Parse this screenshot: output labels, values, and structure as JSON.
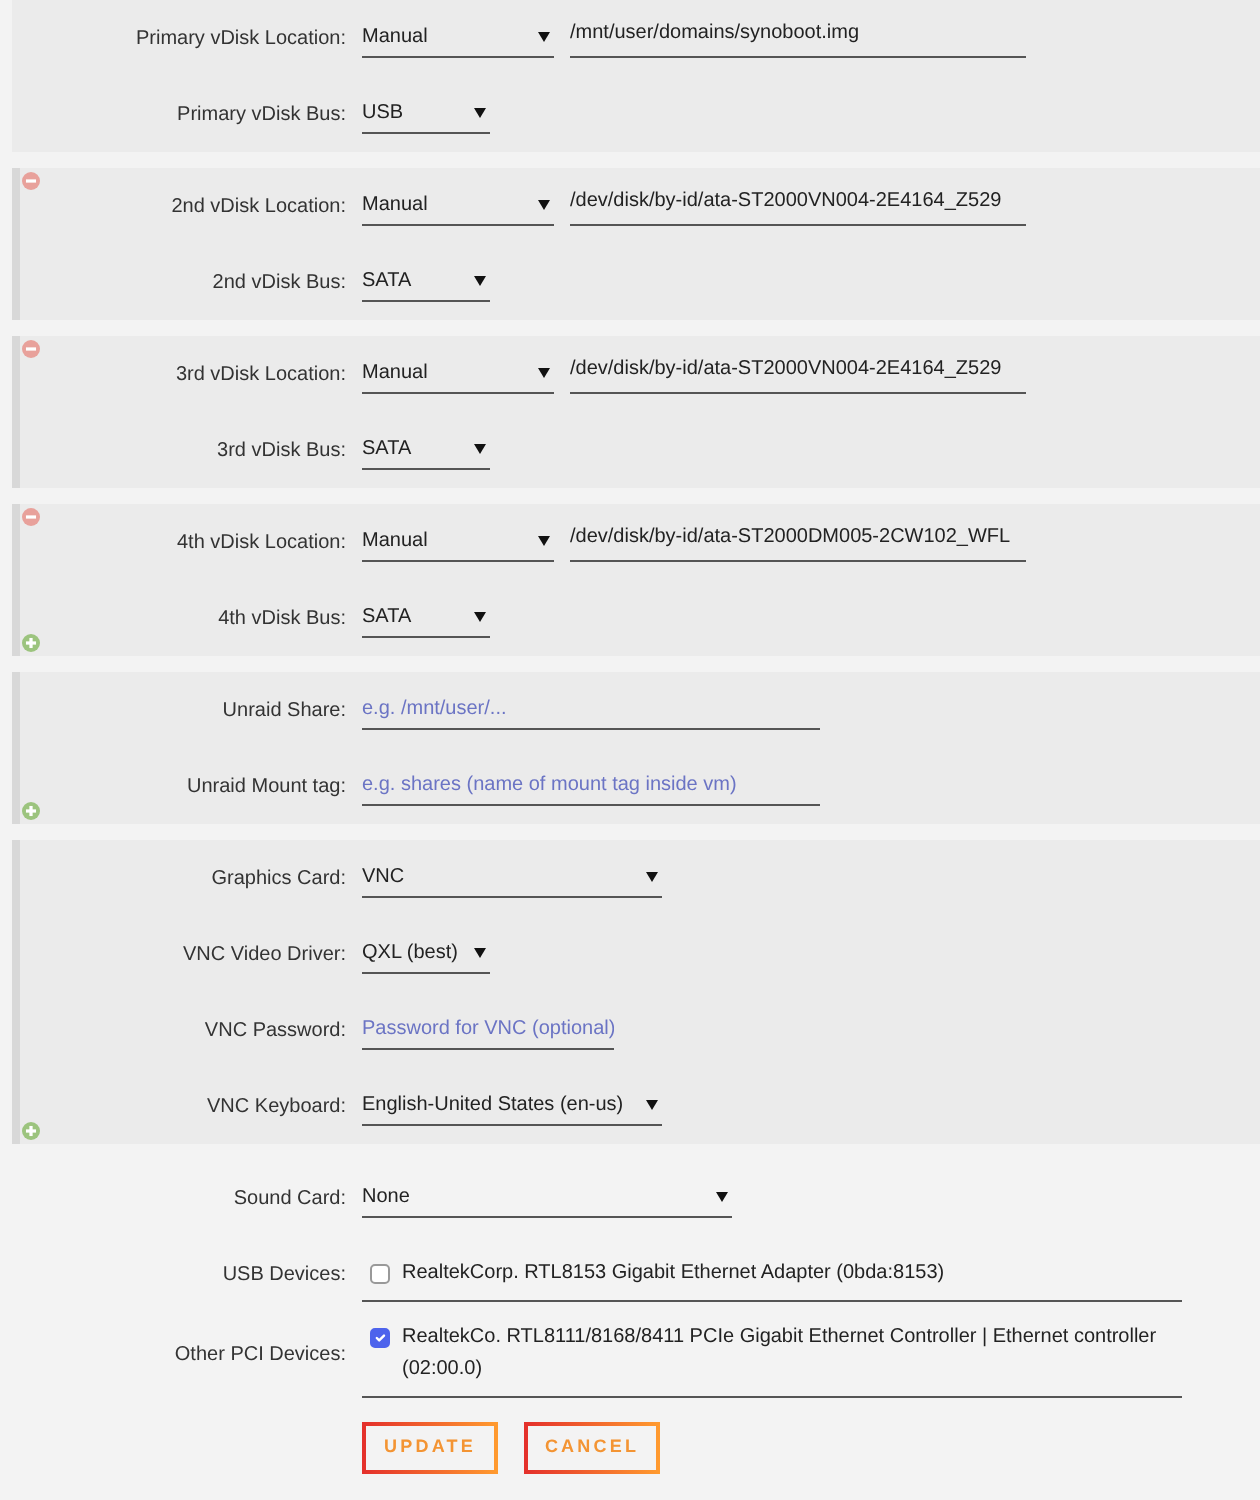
{
  "sections": [
    {
      "kind": "fixed",
      "removable": false,
      "addable": false,
      "rows": [
        {
          "kind": "location",
          "label": "Primary vDisk Location:",
          "value": "Manual",
          "path": "/mnt/user/domains/synoboot.img"
        },
        {
          "kind": "bus",
          "label": "Primary vDisk Bus:",
          "value": "USB"
        }
      ]
    },
    {
      "kind": "extra",
      "removable": true,
      "addable": false,
      "rows": [
        {
          "kind": "location",
          "label": "2nd vDisk Location:",
          "value": "Manual",
          "path": "/dev/disk/by-id/ata-ST2000VN004-2E4164_Z529"
        },
        {
          "kind": "bus",
          "label": "2nd vDisk Bus:",
          "value": "SATA"
        }
      ]
    },
    {
      "kind": "extra",
      "removable": true,
      "addable": false,
      "rows": [
        {
          "kind": "location",
          "label": "3rd vDisk Location:",
          "value": "Manual",
          "path": "/dev/disk/by-id/ata-ST2000VN004-2E4164_Z529"
        },
        {
          "kind": "bus",
          "label": "3rd vDisk Bus:",
          "value": "SATA"
        }
      ]
    },
    {
      "kind": "extra",
      "removable": true,
      "addable": true,
      "rows": [
        {
          "kind": "location",
          "label": "4th vDisk Location:",
          "value": "Manual",
          "path": "/dev/disk/by-id/ata-ST2000DM005-2CW102_WFL"
        },
        {
          "kind": "bus",
          "label": "4th vDisk Bus:",
          "value": "SATA"
        }
      ]
    },
    {
      "kind": "extra",
      "removable": false,
      "addable": true,
      "rows": [
        {
          "kind": "share",
          "label": "Unraid Share:",
          "placeholder": "e.g. /mnt/user/..."
        },
        {
          "kind": "tag",
          "label": "Unraid Mount tag:",
          "placeholder": "e.g. shares (name of mount tag inside vm)"
        }
      ]
    },
    {
      "kind": "extra",
      "removable": false,
      "addable": true,
      "rows": [
        {
          "kind": "graphics",
          "label": "Graphics Card:",
          "value": "VNC"
        },
        {
          "kind": "driver",
          "label": "VNC Video Driver:",
          "value": "QXL (best)"
        },
        {
          "kind": "password",
          "label": "VNC Password:",
          "placeholder": "Password for VNC (optional)"
        },
        {
          "kind": "keyboard",
          "label": "VNC Keyboard:",
          "value": "English-United States (en-us)"
        }
      ]
    },
    {
      "kind": "plain",
      "removable": false,
      "addable": false,
      "rows": [
        {
          "kind": "sound",
          "label": "Sound Card:",
          "value": "None"
        },
        {
          "kind": "devices",
          "label": "USB Devices:",
          "devices": [
            {
              "label": "RealtekCorp. RTL8153 Gigabit Ethernet Adapter (0bda:8153)",
              "checked": false
            }
          ]
        },
        {
          "kind": "devices",
          "label": "Other PCI Devices:",
          "devices": [
            {
              "label": "RealtekCo. RTL8111/8168/8411 PCIe Gigabit Ethernet Controller | Ethernet controller (02:00.0)",
              "checked": true
            }
          ]
        }
      ]
    }
  ],
  "buttons": [
    "UPDATE",
    "CANCEL"
  ]
}
